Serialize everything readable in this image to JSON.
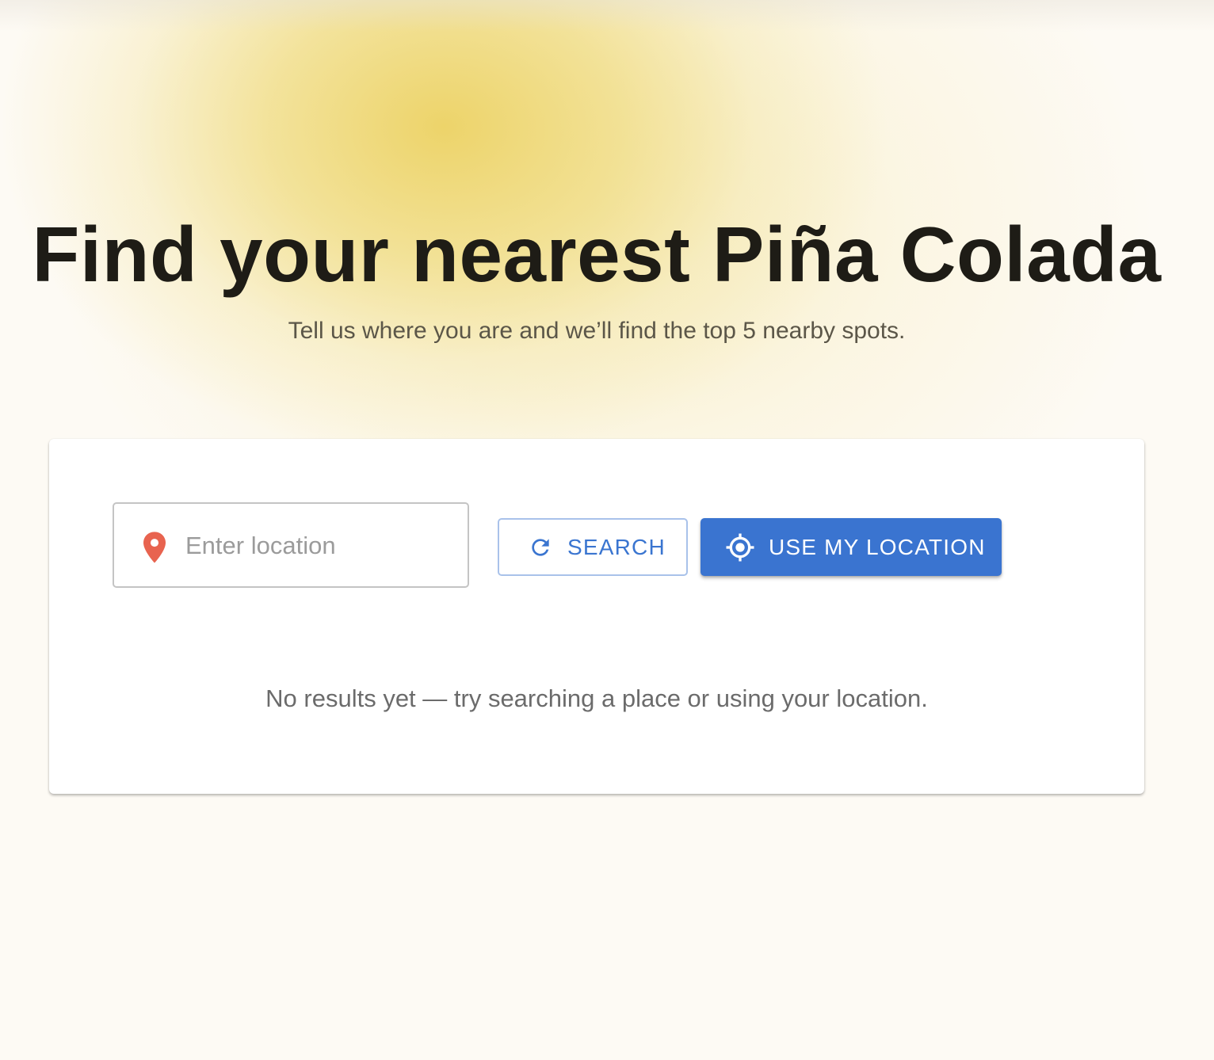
{
  "theme": {
    "background": "#fdfaf4",
    "glow": "#ecd264",
    "title_color": "#1e1c16",
    "primary": "#3a74d0",
    "pin_color": "#e8634f"
  },
  "hero": {
    "title": "Find your nearest Piña Colada",
    "subtitle": "Tell us where you are and we’ll find the top 5 nearby spots."
  },
  "search": {
    "location_placeholder": "Enter location",
    "location_value": "",
    "location_icon": "map-pin-icon",
    "search_button": {
      "label": "SEARCH",
      "icon": "refresh-icon"
    },
    "locate_button": {
      "label": "USE MY LOCATION",
      "icon": "crosshair-icon"
    }
  },
  "results": {
    "empty_message": "No results yet — try searching a place or using your location."
  }
}
